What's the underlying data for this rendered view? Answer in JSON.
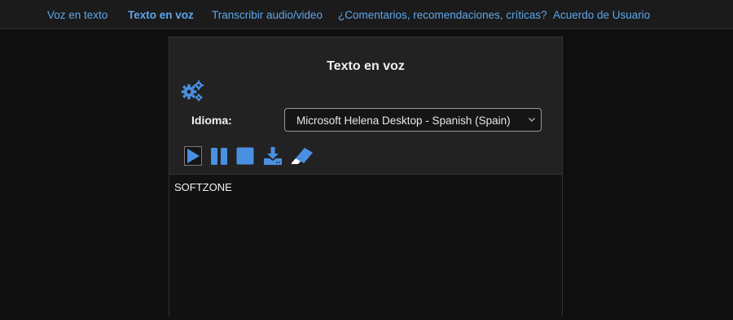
{
  "nav": {
    "items": [
      {
        "label": "Voz en texto"
      },
      {
        "label": "Texto en voz",
        "active": true
      },
      {
        "label": "Transcribir audio/video"
      },
      {
        "label": "¿Comentarios, recomendaciones, críticas?"
      },
      {
        "label": "Acuerdo de Usuario"
      }
    ]
  },
  "panel": {
    "title": "Texto en voz",
    "language_label": "Idioma:",
    "voice_selected": "Microsoft Helena Desktop - Spanish (Spain)",
    "text_value": "SOFTZONE"
  },
  "toolbar": {
    "icons": [
      "play-icon",
      "pause-icon",
      "stop-icon",
      "download-icon",
      "eraser-icon"
    ]
  },
  "colors": {
    "accent": "#5ea6ec",
    "icon_blue": "#4a90e2",
    "background": "#0f0f0f",
    "panel": "#222222"
  }
}
